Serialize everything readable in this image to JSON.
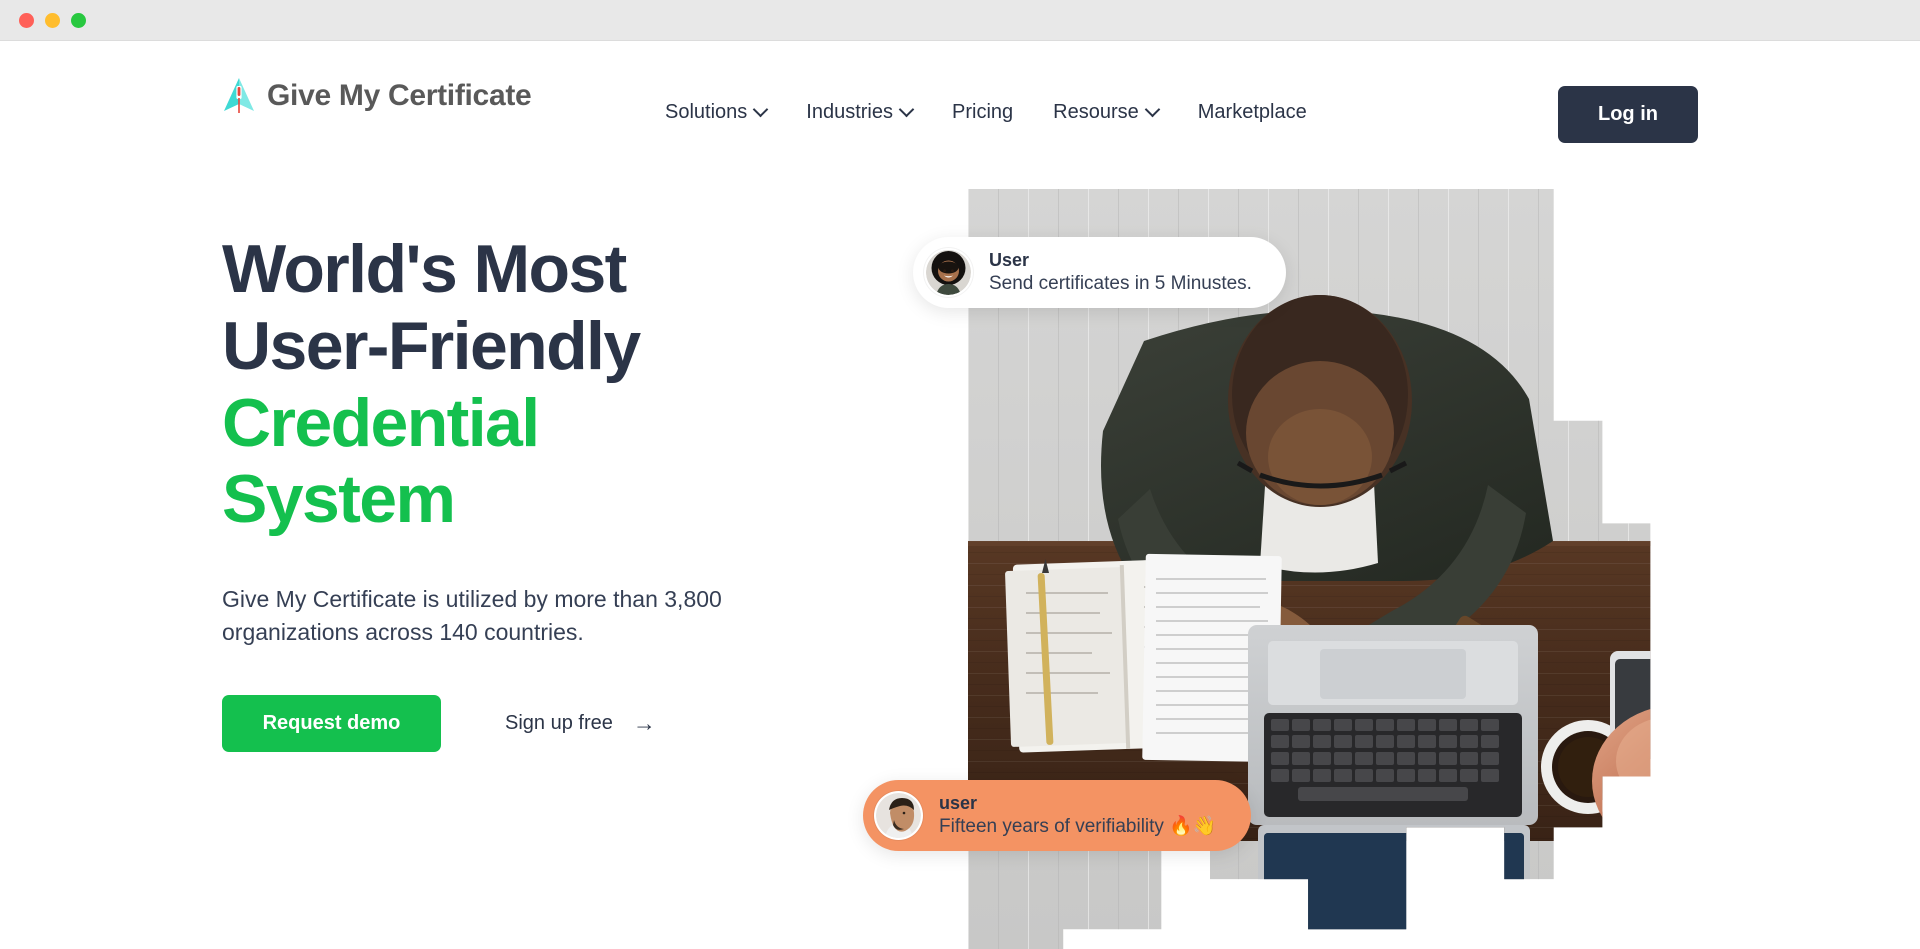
{
  "window": {
    "traffic_lights": [
      {
        "name": "close",
        "color": "#ff6058"
      },
      {
        "name": "minimize",
        "color": "#ffbd2e"
      },
      {
        "name": "maximize",
        "color": "#28c840"
      }
    ]
  },
  "brand": {
    "name": "Give My Certificate",
    "logo_icon": "rocket-arrow-logo-icon",
    "logo_colors": {
      "arrow": "#3fd9d4",
      "arrow_light": "#7fe9e5",
      "body": "#e8453c"
    }
  },
  "nav": {
    "items": [
      {
        "label": "Solutions",
        "has_dropdown": true,
        "icon": "chevron-down-icon"
      },
      {
        "label": "Industries",
        "has_dropdown": true,
        "icon": "chevron-down-icon"
      },
      {
        "label": "Pricing",
        "has_dropdown": false,
        "icon": ""
      },
      {
        "label": "Resourse",
        "has_dropdown": true,
        "icon": "chevron-down-icon"
      },
      {
        "label": "Marketplace",
        "has_dropdown": false,
        "icon": ""
      }
    ],
    "login_label": "Log in"
  },
  "hero": {
    "title_line1": "World's Most",
    "title_line2": "User-Friendly",
    "title_accent1": "Credential",
    "title_accent2": "System",
    "subtitle": "Give My Certificate is utilized by more than 3,800 organizations across 140 countries.",
    "primary_cta": "Request demo",
    "secondary_cta": "Sign up free",
    "secondary_cta_icon": "arrow-right-icon",
    "colors": {
      "heading": "#2b3447",
      "accent_green": "#14c04e",
      "body_text": "#353f54"
    }
  },
  "floating_cards": [
    {
      "id": "card-send-certificates",
      "name": "User",
      "message": "Send certificates in 5 Minustes.",
      "background": "#ffffff",
      "avatar": "woman-smiling-avatar"
    },
    {
      "id": "card-verifiability",
      "name": "user",
      "message": "Fifteen years of verifiability 🔥👋",
      "background": "#f49363",
      "avatar": "man-profile-avatar"
    }
  ],
  "hero_image": {
    "alt": "Top-down photo of a person typing on a laptop at a wooden desk with a notebook, coffee mug and phone",
    "mask": "stepped-pixel-mask"
  }
}
